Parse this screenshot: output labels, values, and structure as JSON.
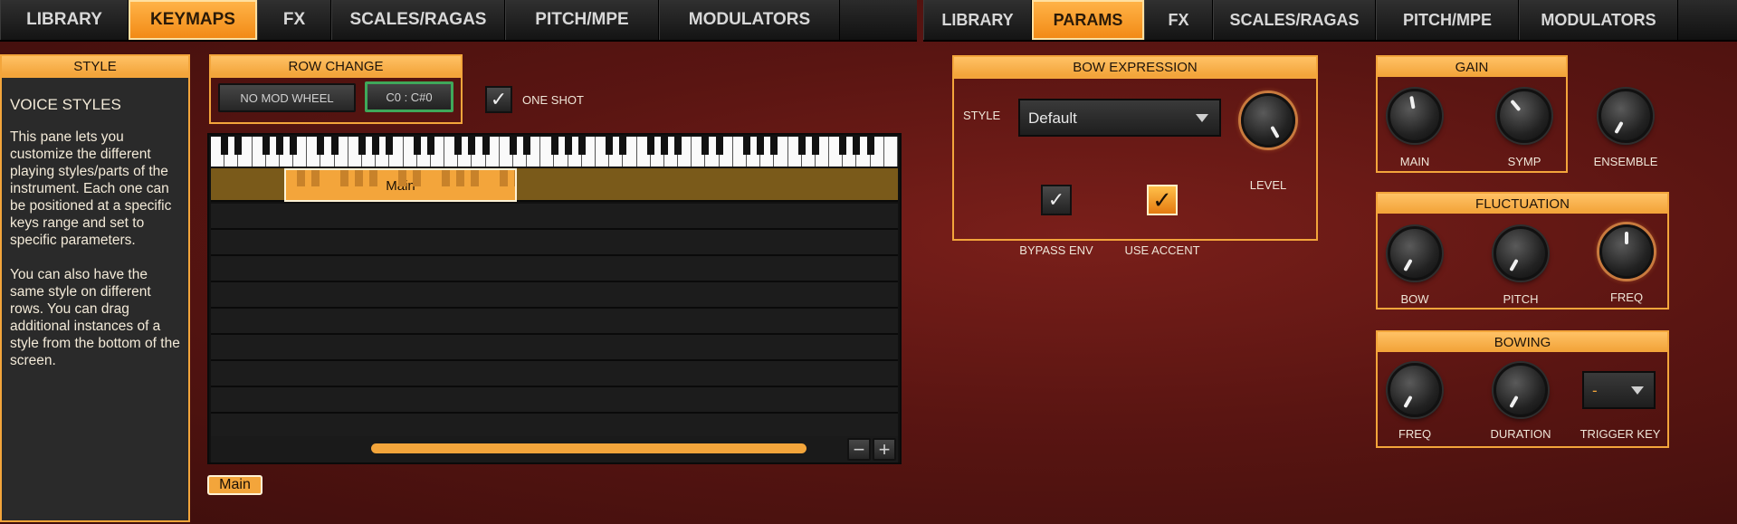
{
  "left_tabs": [
    {
      "label": "LIBRARY",
      "active": false
    },
    {
      "label": "KEYMAPS",
      "active": true
    },
    {
      "label": "FX",
      "active": false
    },
    {
      "label": "SCALES/RAGAS",
      "active": false
    },
    {
      "label": "PITCH/MPE",
      "active": false
    },
    {
      "label": "MODULATORS",
      "active": false
    }
  ],
  "right_tabs": [
    {
      "label": "LIBRARY",
      "active": false
    },
    {
      "label": "PARAMS",
      "active": true
    },
    {
      "label": "FX",
      "active": false
    },
    {
      "label": "SCALES/RAGAS",
      "active": false
    },
    {
      "label": "PITCH/MPE",
      "active": false
    },
    {
      "label": "MODULATORS",
      "active": false
    }
  ],
  "style_panel": {
    "header": "STYLE",
    "title": "VOICE STYLES",
    "paragraph1": "This pane lets you customize the different playing styles/parts of the instrument. Each one can be positioned at a specific keys range and set to specific parameters.",
    "paragraph2": "You can also have the same style on different rows. You can drag additional instances of a style from the bottom of the screen."
  },
  "row_change": {
    "header": "ROW CHANGE",
    "no_mod_wheel": "NO MOD WHEEL",
    "range": "C0 : C#0",
    "one_shot_label": "ONE SHOT",
    "one_shot_checked": true
  },
  "keymap": {
    "zone_label": "Main",
    "row_count": 9,
    "minus": "−",
    "plus": "+"
  },
  "style_chip": "Main",
  "bow_expression": {
    "header": "BOW EXPRESSION",
    "style_label": "STYLE",
    "style_value": "Default",
    "level_label": "LEVEL",
    "bypass_env_label": "BYPASS ENV",
    "bypass_env_checked": true,
    "use_accent_label": "USE ACCENT",
    "use_accent_checked": true
  },
  "gain": {
    "header": "GAIN",
    "main": "MAIN",
    "symp": "SYMP",
    "ensemble": "ENSEMBLE"
  },
  "fluctuation": {
    "header": "FLUCTUATION",
    "bow": "BOW",
    "pitch": "PITCH",
    "freq": "FREQ"
  },
  "bowing": {
    "header": "BOWING",
    "freq": "FREQ",
    "duration": "DURATION",
    "trigger_key": "TRIGGER KEY",
    "trigger_value": "-"
  },
  "colors": {
    "accent": "#f3a53b",
    "active_tab": "#f28a16",
    "zone": "#7a5a1a",
    "checked": "#e47a10"
  }
}
